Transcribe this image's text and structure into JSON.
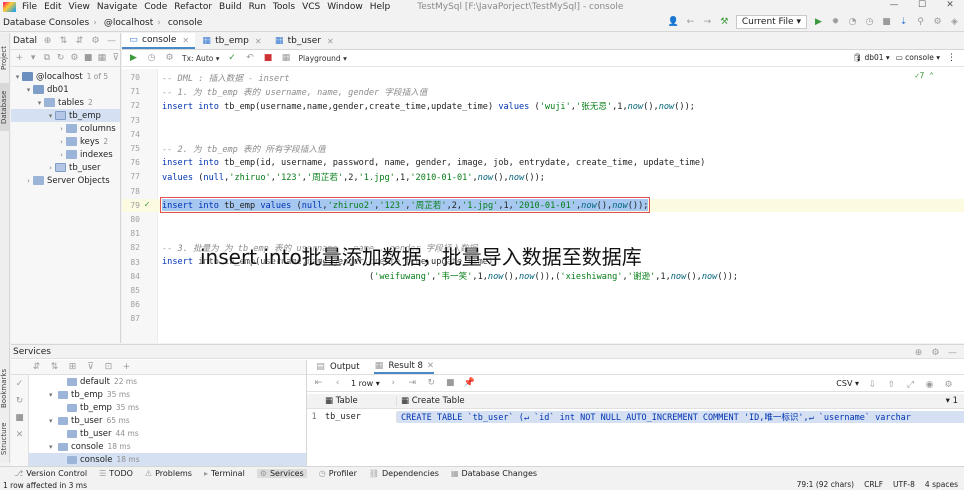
{
  "menu": {
    "items": [
      "File",
      "Edit",
      "View",
      "Navigate",
      "Code",
      "Refactor",
      "Build",
      "Run",
      "Tools",
      "VCS",
      "Window",
      "Help"
    ],
    "window_title": "TestMySql [F:\\JavaPorject\\TestMySql] - console"
  },
  "window_buttons": {
    "minimize": "—",
    "maximize": "☐",
    "close": "✕"
  },
  "navbar": {
    "crumbs": [
      "Database Consoles",
      "@localhost",
      "console"
    ],
    "run_config": "Current File"
  },
  "side_tabs": {
    "project": "Project",
    "database": "Database",
    "bookmarks": "Bookmarks",
    "structure": "Structure"
  },
  "db_panel": {
    "title": "Datal",
    "tree": [
      {
        "label": "@localhost",
        "meta": "1 of 5",
        "indent": 0,
        "icon": "host-icon",
        "arrow": "▾"
      },
      {
        "label": "db01",
        "meta": "",
        "indent": 1,
        "icon": "database-icon",
        "arrow": "▾"
      },
      {
        "label": "tables",
        "meta": "2",
        "indent": 2,
        "icon": "folder-icon",
        "arrow": "▾"
      },
      {
        "label": "tb_emp",
        "meta": "",
        "indent": 3,
        "icon": "table-icon",
        "arrow": "▾",
        "selected": true
      },
      {
        "label": "columns",
        "meta": "",
        "indent": 4,
        "icon": "folder-icon",
        "arrow": "›"
      },
      {
        "label": "keys",
        "meta": "2",
        "indent": 4,
        "icon": "folder-icon",
        "arrow": "›"
      },
      {
        "label": "indexes",
        "meta": "",
        "indent": 4,
        "icon": "folder-icon",
        "arrow": "›"
      },
      {
        "label": "tb_user",
        "meta": "",
        "indent": 3,
        "icon": "table-icon",
        "arrow": "›"
      },
      {
        "label": "Server Objects",
        "meta": "",
        "indent": 1,
        "icon": "folder-icon",
        "arrow": "›"
      }
    ]
  },
  "editor": {
    "tabs": [
      {
        "label": "console",
        "active": true
      },
      {
        "label": "tb_emp",
        "active": false
      },
      {
        "label": "tb_user",
        "active": false
      }
    ],
    "tx_mode": "Tx: Auto",
    "playground": "Playground",
    "schema": "db01",
    "session": "console",
    "inspection_count": "7",
    "lines": [
      {
        "n": "70",
        "parts": [
          [
            "cm",
            "-- DML : 插入数据 - insert"
          ]
        ]
      },
      {
        "n": "71",
        "parts": [
          [
            "cm",
            "-- 1. 为 tb_emp 表的 username, name, gender 字段插入值"
          ]
        ]
      },
      {
        "n": "72",
        "parts": [
          [
            "kw",
            "insert into "
          ],
          [
            "",
            "tb_emp(username,name,gender,create_time,update_time) "
          ],
          [
            "kw",
            "values "
          ],
          [
            "",
            "("
          ],
          [
            "str",
            "'wuji'"
          ],
          [
            "",
            ","
          ],
          [
            "str",
            "'张无忌'"
          ],
          [
            "",
            ",1,"
          ],
          [
            "fn",
            "now"
          ],
          [
            "",
            "(),"
          ],
          [
            "fn",
            "now"
          ],
          [
            "",
            "());"
          ]
        ]
      },
      {
        "n": "73",
        "parts": []
      },
      {
        "n": "74",
        "parts": []
      },
      {
        "n": "75",
        "parts": [
          [
            "cm",
            "-- 2. 为 tb_emp 表的 所有字段插入值"
          ]
        ]
      },
      {
        "n": "76",
        "parts": [
          [
            "kw",
            "insert into "
          ],
          [
            "",
            "tb_emp(id, username, password, name, gender, image, job, entrydate, create_time, update_time)"
          ]
        ]
      },
      {
        "n": "77",
        "parts": [
          [
            "kw",
            "values "
          ],
          [
            "",
            "("
          ],
          [
            "kw",
            "null"
          ],
          [
            "",
            ","
          ],
          [
            "str",
            "'zhiruo'"
          ],
          [
            "",
            ","
          ],
          [
            "str",
            "'123'"
          ],
          [
            "",
            ","
          ],
          [
            "str",
            "'周芷若'"
          ],
          [
            "",
            ",2,"
          ],
          [
            "str",
            "'1.jpg'"
          ],
          [
            "",
            ",1,"
          ],
          [
            "str",
            "'2010-01-01'"
          ],
          [
            "",
            ","
          ],
          [
            "fn",
            "now"
          ],
          [
            "",
            "(),"
          ],
          [
            "fn",
            "now"
          ],
          [
            "",
            "());"
          ]
        ]
      },
      {
        "n": "78",
        "parts": []
      },
      {
        "n": "79",
        "parts": [
          [
            "kw",
            "insert into "
          ],
          [
            "",
            "tb_emp "
          ],
          [
            "kw",
            "values "
          ],
          [
            "",
            "("
          ],
          [
            "kw",
            "null"
          ],
          [
            "",
            ","
          ],
          [
            "str",
            "'zhiruo2'"
          ],
          [
            "",
            ","
          ],
          [
            "str",
            "'123'"
          ],
          [
            "",
            ","
          ],
          [
            "str",
            "'周芷若'"
          ],
          [
            "",
            ",2,"
          ],
          [
            "str",
            "'1.jpg'"
          ],
          [
            "",
            ",1,"
          ],
          [
            "str",
            "'2010-01-01'"
          ],
          [
            "",
            ","
          ],
          [
            "fn",
            "now"
          ],
          [
            "",
            "(),"
          ],
          [
            "fn",
            "now"
          ],
          [
            "",
            "());"
          ]
        ],
        "current": true,
        "selected": true
      },
      {
        "n": "80",
        "parts": []
      },
      {
        "n": "81",
        "parts": []
      },
      {
        "n": "82",
        "parts": [
          [
            "cm",
            "-- 3. 批量为 为 tb_emp 表的 username , name , gender 字段插入数据"
          ]
        ]
      },
      {
        "n": "83",
        "parts": [
          [
            "kw",
            "insert "
          ],
          [
            "",
            "into tb_emp(username,name,gender,create_time,update_time)"
          ]
        ]
      },
      {
        "n": "84",
        "parts": [
          [
            "",
            "                                        ("
          ],
          [
            "str",
            "'weifuwang'"
          ],
          [
            "",
            ","
          ],
          [
            "str",
            "'韦一笑'"
          ],
          [
            "",
            ",1,"
          ],
          [
            "fn",
            "now"
          ],
          [
            "",
            "(),"
          ],
          [
            "fn",
            "now"
          ],
          [
            "",
            "()),("
          ],
          [
            "str",
            "'xieshiwang'"
          ],
          [
            "",
            ","
          ],
          [
            "str",
            "'谢逊'"
          ],
          [
            "",
            ",1,"
          ],
          [
            "fn",
            "now"
          ],
          [
            "",
            "(),"
          ],
          [
            "fn",
            "now"
          ],
          [
            "",
            "());"
          ]
        ]
      },
      {
        "n": "85",
        "parts": []
      },
      {
        "n": "86",
        "parts": []
      },
      {
        "n": "87",
        "parts": []
      }
    ]
  },
  "overlay_caption": "insert into批量添加数据，批量导入数据至数据库",
  "services": {
    "title": "Services",
    "tree": [
      {
        "label": "default",
        "meta": "22 ms",
        "indent": 3
      },
      {
        "label": "tb_emp",
        "meta": "35 ms",
        "indent": 2,
        "arrow": "▾"
      },
      {
        "label": "tb_emp",
        "meta": "35 ms",
        "indent": 3
      },
      {
        "label": "tb_user",
        "meta": "65 ms",
        "indent": 2,
        "arrow": "▾"
      },
      {
        "label": "tb_user",
        "meta": "44 ms",
        "indent": 3
      },
      {
        "label": "console",
        "meta": "18 ms",
        "indent": 2,
        "arrow": "▾"
      },
      {
        "label": "console",
        "meta": "18 ms",
        "indent": 3,
        "selected": true
      }
    ],
    "result_tabs": [
      {
        "label": "Output",
        "active": false
      },
      {
        "label": "Result 8",
        "active": true
      }
    ],
    "row_count": "1 row",
    "export_format": "CSV",
    "grid": {
      "columns": [
        "Table",
        "Create Table"
      ],
      "sort_indicator": "1",
      "rows": [
        {
          "index": "1",
          "table": "tb_user",
          "create": "CREATE TABLE `tb_user` (↵   `id` int NOT NULL AUTO_INCREMENT COMMENT 'ID,唯一标识',↵   `username` varchar"
        }
      ]
    }
  },
  "bottom_tabs": [
    "Version Control",
    "TODO",
    "Problems",
    "Terminal",
    "Services",
    "Profiler",
    "Dependencies",
    "Database Changes"
  ],
  "status": {
    "message": "1 row affected in 3 ms",
    "position": "79:1 (92 chars)",
    "line_sep": "CRLF",
    "encoding": "UTF-8",
    "indent": "4 spaces"
  }
}
